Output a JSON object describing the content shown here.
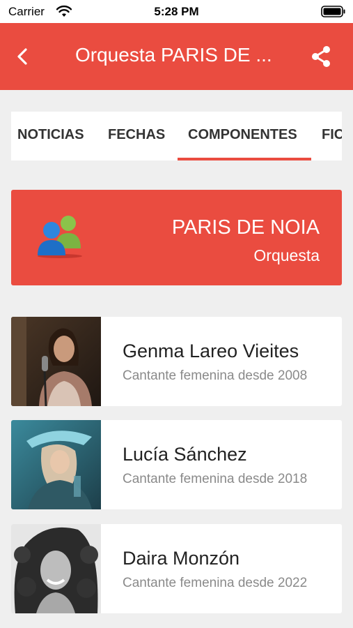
{
  "status_bar": {
    "carrier": "Carrier",
    "time": "5:28 PM"
  },
  "app_bar": {
    "title": "Orquesta PARIS DE ..."
  },
  "tabs": [
    {
      "label": "NOTICIAS",
      "active": false
    },
    {
      "label": "FECHAS",
      "active": false
    },
    {
      "label": "COMPONENTES",
      "active": true
    },
    {
      "label": "FIC",
      "active": false
    }
  ],
  "banner": {
    "title": "PARIS DE NOIA",
    "subtitle": "Orquesta",
    "icon": "users-icon"
  },
  "members": [
    {
      "name": "Genma Lareo Vieites",
      "role": "Cantante femenina desde 2008"
    },
    {
      "name": "Lucía Sánchez",
      "role": "Cantante femenina desde 2018"
    },
    {
      "name": "Daira Monzón",
      "role": "Cantante femenina desde 2022"
    }
  ],
  "colors": {
    "accent": "#ea4c40",
    "background": "#efefef",
    "card": "#ffffff"
  }
}
